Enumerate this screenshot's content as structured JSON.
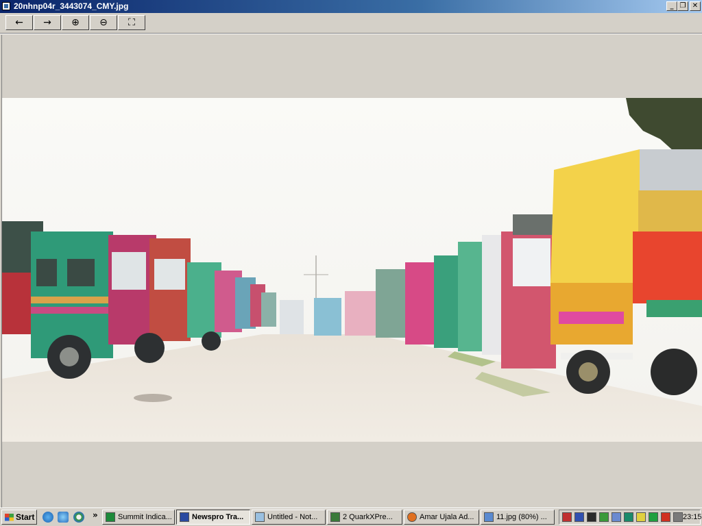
{
  "window": {
    "title": "20nhnp04r_3443074_CMY.jpg",
    "minimize": "_",
    "maximize": "❐",
    "close": "✕"
  },
  "toolbar": {
    "back_glyph": "←",
    "forward_glyph": "→",
    "zoom_in_glyph": "⊕",
    "zoom_out_glyph": "⊖",
    "fit_glyph": "⛶"
  },
  "taskbar": {
    "start_label": "Start",
    "more_glyph": "»",
    "tasks": [
      {
        "label": "Summit Indica...",
        "icon": "excel-icon"
      },
      {
        "label": "Newspro Tra...",
        "icon": "newspro-icon"
      },
      {
        "label": "Untitled - Not...",
        "icon": "notepad-icon"
      },
      {
        "label": "2 QuarkXPre...",
        "icon": "quark-icon"
      },
      {
        "label": "Amar Ujala Ad...",
        "icon": "firefox-icon"
      },
      {
        "label": "11.jpg (80%) ...",
        "icon": "image-icon"
      }
    ],
    "clock": "23:15"
  },
  "colors": {
    "titlebar": "#0a246a",
    "chrome": "#d4d0c8"
  }
}
